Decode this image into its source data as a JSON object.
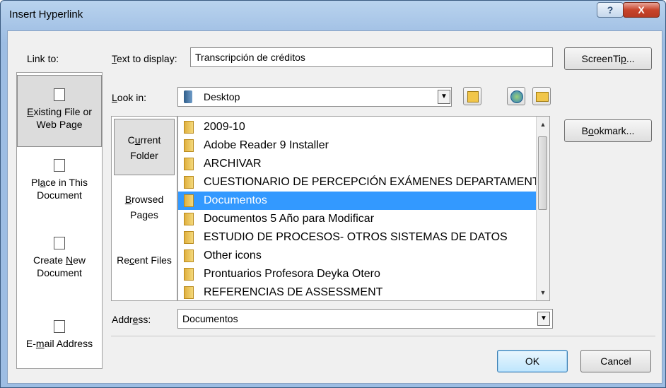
{
  "dialog": {
    "title": "Insert Hyperlink",
    "help_label": "?",
    "close_label": "X"
  },
  "link_to": {
    "label": "Link to:",
    "items": [
      {
        "label_pre": "",
        "label_u": "E",
        "label_post": "xisting File or Web Page"
      },
      {
        "label_pre": "Pl",
        "label_u": "a",
        "label_post": "ce in This Document"
      },
      {
        "label_pre": "Create ",
        "label_u": "N",
        "label_post": "ew Document"
      },
      {
        "label_pre": "E-",
        "label_u": "m",
        "label_post": "ail Address"
      }
    ]
  },
  "text_to_display": {
    "label_u": "T",
    "label_rest": "ext to display:",
    "value": "Transcripción de créditos"
  },
  "screentip_button": {
    "label_pre": "ScreenTi",
    "label_u": "p",
    "label_post": "..."
  },
  "look_in": {
    "label_u": "L",
    "label_rest": "ook in:",
    "value": "Desktop"
  },
  "sub_nav": [
    {
      "label_pre": "C",
      "label_u": "u",
      "label_post": "rrent Folder"
    },
    {
      "label_pre": "",
      "label_u": "B",
      "label_post": "rowsed Pages"
    },
    {
      "label_pre": "Re",
      "label_u": "c",
      "label_post": "ent Files"
    }
  ],
  "files": [
    "2009-10",
    "Adobe Reader 9 Installer",
    "ARCHIVAR",
    "CUESTIONARIO DE PERCEPCIÓN EXÁMENES DEPARTAMENTALES",
    "Documentos",
    "Documentos 5 Año para Modificar",
    "ESTUDIO DE PROCESOS- OTROS SISTEMAS DE DATOS",
    "Other icons",
    "Prontuarios Profesora Deyka Otero",
    "REFERENCIAS DE ASSESSMENT"
  ],
  "selected_file": "Documentos",
  "bookmark_button": {
    "label_pre": "B",
    "label_u": "o",
    "label_post": "okmark..."
  },
  "address": {
    "label_pre": "Addr",
    "label_u": "e",
    "label_post": "ss:",
    "value": "Documentos"
  },
  "ok_label": "OK",
  "cancel_label": "Cancel"
}
